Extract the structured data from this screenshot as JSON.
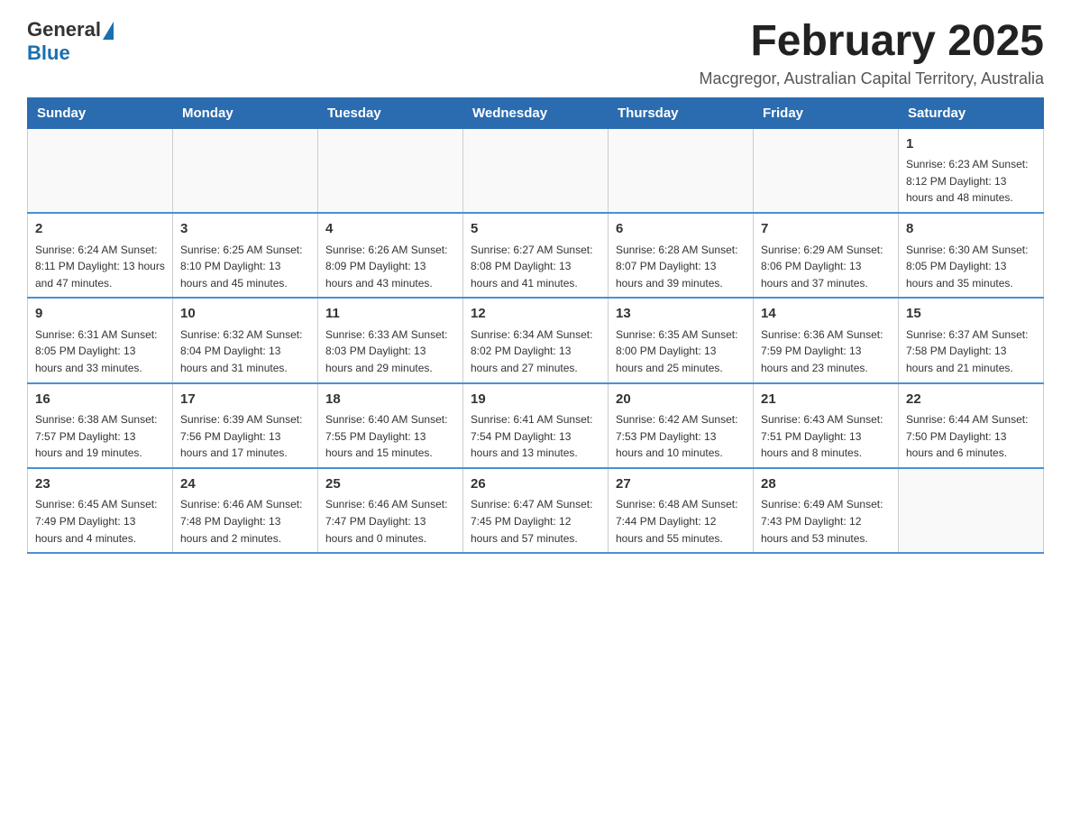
{
  "header": {
    "logo_general": "General",
    "logo_blue": "Blue",
    "month_title": "February 2025",
    "subtitle": "Macgregor, Australian Capital Territory, Australia"
  },
  "weekdays": [
    "Sunday",
    "Monday",
    "Tuesday",
    "Wednesday",
    "Thursday",
    "Friday",
    "Saturday"
  ],
  "weeks": [
    [
      {
        "day": "",
        "info": ""
      },
      {
        "day": "",
        "info": ""
      },
      {
        "day": "",
        "info": ""
      },
      {
        "day": "",
        "info": ""
      },
      {
        "day": "",
        "info": ""
      },
      {
        "day": "",
        "info": ""
      },
      {
        "day": "1",
        "info": "Sunrise: 6:23 AM\nSunset: 8:12 PM\nDaylight: 13 hours and 48 minutes."
      }
    ],
    [
      {
        "day": "2",
        "info": "Sunrise: 6:24 AM\nSunset: 8:11 PM\nDaylight: 13 hours and 47 minutes."
      },
      {
        "day": "3",
        "info": "Sunrise: 6:25 AM\nSunset: 8:10 PM\nDaylight: 13 hours and 45 minutes."
      },
      {
        "day": "4",
        "info": "Sunrise: 6:26 AM\nSunset: 8:09 PM\nDaylight: 13 hours and 43 minutes."
      },
      {
        "day": "5",
        "info": "Sunrise: 6:27 AM\nSunset: 8:08 PM\nDaylight: 13 hours and 41 minutes."
      },
      {
        "day": "6",
        "info": "Sunrise: 6:28 AM\nSunset: 8:07 PM\nDaylight: 13 hours and 39 minutes."
      },
      {
        "day": "7",
        "info": "Sunrise: 6:29 AM\nSunset: 8:06 PM\nDaylight: 13 hours and 37 minutes."
      },
      {
        "day": "8",
        "info": "Sunrise: 6:30 AM\nSunset: 8:05 PM\nDaylight: 13 hours and 35 minutes."
      }
    ],
    [
      {
        "day": "9",
        "info": "Sunrise: 6:31 AM\nSunset: 8:05 PM\nDaylight: 13 hours and 33 minutes."
      },
      {
        "day": "10",
        "info": "Sunrise: 6:32 AM\nSunset: 8:04 PM\nDaylight: 13 hours and 31 minutes."
      },
      {
        "day": "11",
        "info": "Sunrise: 6:33 AM\nSunset: 8:03 PM\nDaylight: 13 hours and 29 minutes."
      },
      {
        "day": "12",
        "info": "Sunrise: 6:34 AM\nSunset: 8:02 PM\nDaylight: 13 hours and 27 minutes."
      },
      {
        "day": "13",
        "info": "Sunrise: 6:35 AM\nSunset: 8:00 PM\nDaylight: 13 hours and 25 minutes."
      },
      {
        "day": "14",
        "info": "Sunrise: 6:36 AM\nSunset: 7:59 PM\nDaylight: 13 hours and 23 minutes."
      },
      {
        "day": "15",
        "info": "Sunrise: 6:37 AM\nSunset: 7:58 PM\nDaylight: 13 hours and 21 minutes."
      }
    ],
    [
      {
        "day": "16",
        "info": "Sunrise: 6:38 AM\nSunset: 7:57 PM\nDaylight: 13 hours and 19 minutes."
      },
      {
        "day": "17",
        "info": "Sunrise: 6:39 AM\nSunset: 7:56 PM\nDaylight: 13 hours and 17 minutes."
      },
      {
        "day": "18",
        "info": "Sunrise: 6:40 AM\nSunset: 7:55 PM\nDaylight: 13 hours and 15 minutes."
      },
      {
        "day": "19",
        "info": "Sunrise: 6:41 AM\nSunset: 7:54 PM\nDaylight: 13 hours and 13 minutes."
      },
      {
        "day": "20",
        "info": "Sunrise: 6:42 AM\nSunset: 7:53 PM\nDaylight: 13 hours and 10 minutes."
      },
      {
        "day": "21",
        "info": "Sunrise: 6:43 AM\nSunset: 7:51 PM\nDaylight: 13 hours and 8 minutes."
      },
      {
        "day": "22",
        "info": "Sunrise: 6:44 AM\nSunset: 7:50 PM\nDaylight: 13 hours and 6 minutes."
      }
    ],
    [
      {
        "day": "23",
        "info": "Sunrise: 6:45 AM\nSunset: 7:49 PM\nDaylight: 13 hours and 4 minutes."
      },
      {
        "day": "24",
        "info": "Sunrise: 6:46 AM\nSunset: 7:48 PM\nDaylight: 13 hours and 2 minutes."
      },
      {
        "day": "25",
        "info": "Sunrise: 6:46 AM\nSunset: 7:47 PM\nDaylight: 13 hours and 0 minutes."
      },
      {
        "day": "26",
        "info": "Sunrise: 6:47 AM\nSunset: 7:45 PM\nDaylight: 12 hours and 57 minutes."
      },
      {
        "day": "27",
        "info": "Sunrise: 6:48 AM\nSunset: 7:44 PM\nDaylight: 12 hours and 55 minutes."
      },
      {
        "day": "28",
        "info": "Sunrise: 6:49 AM\nSunset: 7:43 PM\nDaylight: 12 hours and 53 minutes."
      },
      {
        "day": "",
        "info": ""
      }
    ]
  ]
}
